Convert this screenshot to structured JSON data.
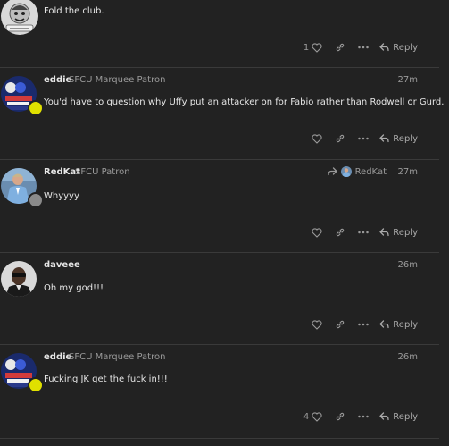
{
  "posts": [
    {
      "username": "",
      "user_title": "",
      "date": "",
      "body": "Fold the club.",
      "like_count": "1",
      "reply_label": "Reply"
    },
    {
      "username": "eddie",
      "user_title": "SFCU Marquee Patron",
      "date": "27m",
      "body": "You'd have to question why Uffy put an attacker on for Fabio rather than Rodwell or Gurd.",
      "like_count": "",
      "reply_label": "Reply"
    },
    {
      "username": "RedKat",
      "user_title": "SFCU Patron",
      "date": "27m",
      "reply_to_user": "RedKat",
      "body": "Whyyyy",
      "like_count": "",
      "reply_label": "Reply"
    },
    {
      "username": "daveee",
      "user_title": "",
      "date": "26m",
      "body": "Oh my god!!!",
      "like_count": "",
      "reply_label": "Reply"
    },
    {
      "username": "eddie",
      "user_title": "SFCU Marquee Patron",
      "date": "26m",
      "body": "Fucking JK get the fuck in!!!",
      "like_count": "4",
      "reply_label": "Reply"
    }
  ],
  "icons": {
    "like": "heart-icon",
    "share": "link-icon",
    "more": "ellipsis-icon",
    "reply": "reply-arrow-icon"
  },
  "colors": {
    "background": "#222222",
    "divider": "#3a3a3a",
    "status_dot_yellow": "#e0e000",
    "status_dot_grey": "#8a8a8a"
  }
}
